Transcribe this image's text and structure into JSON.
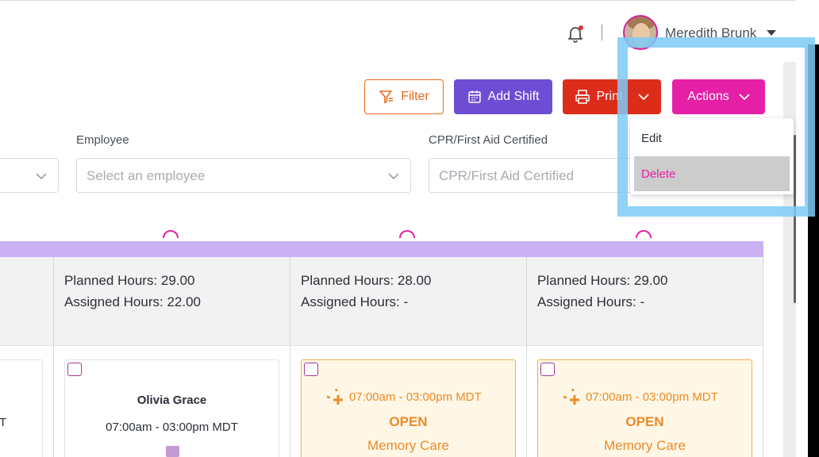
{
  "header": {
    "user_name": "Meredith Brunk"
  },
  "toolbar": {
    "filter_label": "Filter",
    "add_shift_label": "Add Shift",
    "print_label": "Print",
    "actions_label": "Actions"
  },
  "filters": {
    "employee": {
      "label": "Employee",
      "placeholder": "Select an employee"
    },
    "cpr": {
      "label": "CPR/First Aid Certified",
      "placeholder": "CPR/First Aid Certified"
    }
  },
  "actions_menu": {
    "items": [
      "Edit",
      "Delete"
    ],
    "highlighted": "Delete"
  },
  "schedule": {
    "partial_left_text": "T",
    "columns": [
      {
        "planned": "Planned Hours: 29.00",
        "assigned": "Assigned Hours: 22.00",
        "card": {
          "type": "assigned",
          "name": "Olivia Grace",
          "time": "07:00am - 03:00pm MDT"
        }
      },
      {
        "planned": "Planned Hours: 28.00",
        "assigned": "Assigned Hours: -",
        "card": {
          "type": "open",
          "time": "07:00am - 03:00pm MDT",
          "status": "OPEN",
          "unit": "Memory Care"
        }
      },
      {
        "planned": "Planned Hours: 29.00",
        "assigned": "Assigned Hours: -",
        "card": {
          "type": "open",
          "time": "07:00am - 03:00pm MDT",
          "status": "OPEN",
          "unit": "Memory Care"
        }
      }
    ]
  },
  "colors": {
    "filter": "#e96a1c",
    "add_shift": "#6e4dd5",
    "print": "#dc2d1b",
    "actions": "#e520a6",
    "open_shift": "#ec8a28",
    "day_bar": "#c9b1f4"
  }
}
